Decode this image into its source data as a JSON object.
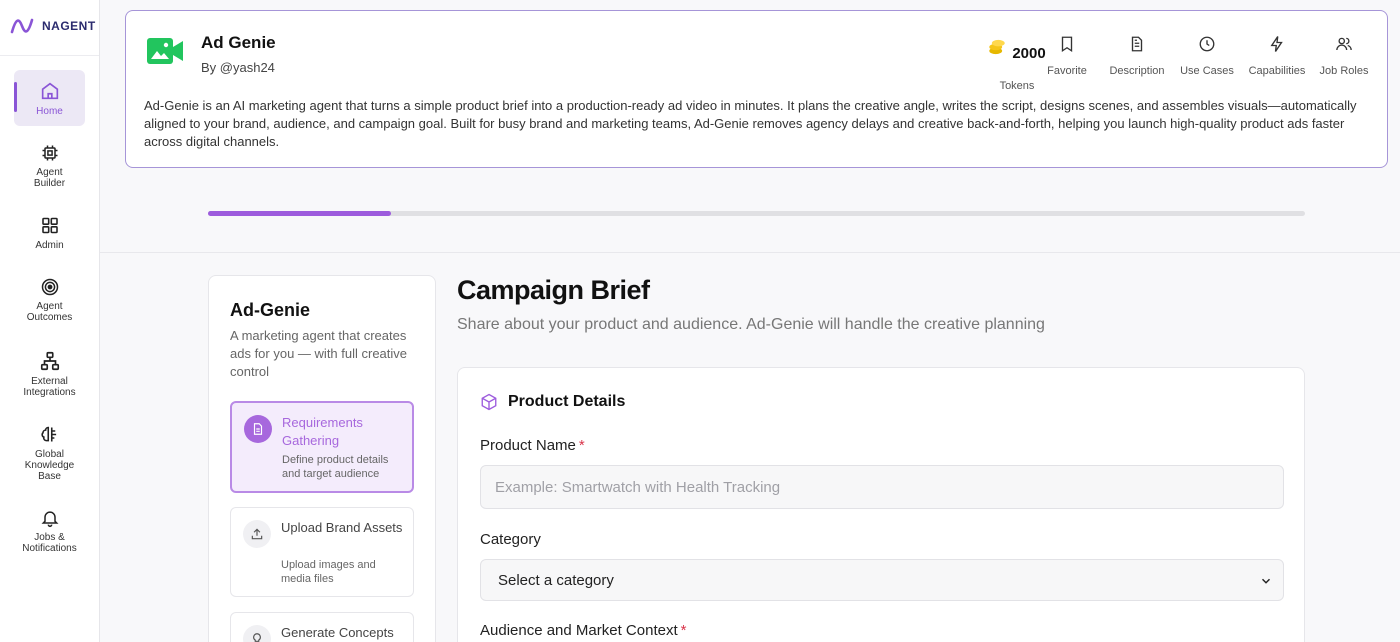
{
  "brand": {
    "logo_text": "NAGENT"
  },
  "sidebar": {
    "items": [
      {
        "label": "Home"
      },
      {
        "label": "Agent\nBuilder"
      },
      {
        "label": "Admin"
      },
      {
        "label": "Agent\nOutcomes"
      },
      {
        "label": "External\nIntegrations"
      },
      {
        "label": "Global\nKnowledge\nBase"
      },
      {
        "label": "Jobs &\nNotifications"
      }
    ]
  },
  "agent": {
    "title": "Ad Genie",
    "author": "By @yash24",
    "description": "Ad-Genie is an AI marketing agent that turns a simple product brief into a production-ready ad video in minutes. It plans the creative angle, writes the script, designs scenes, and assembles visuals—automatically aligned to your brand, audience, and campaign goal. Built for busy brand and marketing teams, Ad-Genie removes agency delays and creative back-and-forth, helping you launch high-quality product ads faster across digital channels."
  },
  "stats": {
    "tokens_value": "2000",
    "tokens_label": "Tokens",
    "favorite": "Favorite",
    "description": "Description",
    "use_cases": "Use Cases",
    "capabilities": "Capabilities",
    "job_roles": "Job Roles"
  },
  "progress": {
    "fraction": 0.167
  },
  "steps_panel": {
    "title": "Ad-Genie",
    "subtitle": "A marketing agent that creates ads for you — with full creative control",
    "steps": [
      {
        "label": "Requirements Gathering",
        "desc": "Define product details and target audience"
      },
      {
        "label": "Upload Brand Assets",
        "desc": "Upload images and media files"
      },
      {
        "label": "Generate Concepts",
        "desc": ""
      }
    ]
  },
  "main": {
    "title": "Campaign Brief",
    "subtitle": "Share about your product and audience. Ad-Genie will handle the creative planning",
    "section_title": "Product Details",
    "product_name_label": "Product Name",
    "product_name_placeholder": "Example: Smartwatch with Health Tracking",
    "product_name_value": "",
    "category_label": "Category",
    "category_value": "Select a category",
    "audience_label": "Audience and Market Context",
    "required_mark": "*"
  },
  "colors": {
    "accent": "#9d5cdd",
    "agent_icon": "#22c55e",
    "required": "#d9344a"
  }
}
